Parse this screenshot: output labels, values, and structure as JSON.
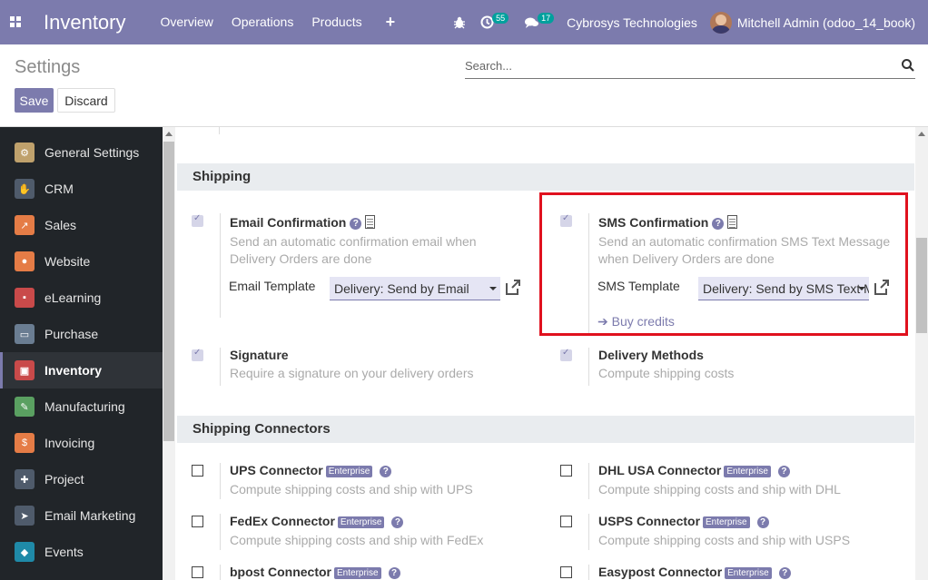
{
  "navbar": {
    "brand": "Inventory",
    "menu": [
      "Overview",
      "Operations",
      "Products"
    ],
    "plus": "+",
    "activity_count": "55",
    "messages_count": "17",
    "company": "Cybrosys Technologies",
    "user": "Mitchell Admin (odoo_14_book)"
  },
  "control": {
    "title": "Settings",
    "save_label": "Save",
    "discard_label": "Discard",
    "search_placeholder": "Search..."
  },
  "sidebar": {
    "items": [
      {
        "label": "General Settings",
        "icon": "gear-icon",
        "color": "#bfa16c"
      },
      {
        "label": "CRM",
        "icon": "handshake-icon",
        "color": "#4f5b6b"
      },
      {
        "label": "Sales",
        "icon": "chart-icon",
        "color": "#e57c46"
      },
      {
        "label": "Website",
        "icon": "globe-icon",
        "color": "#e57c46"
      },
      {
        "label": "eLearning",
        "icon": "elearning-icon",
        "color": "#c94a4a"
      },
      {
        "label": "Purchase",
        "icon": "card-icon",
        "color": "#6a7d92"
      },
      {
        "label": "Inventory",
        "icon": "box-icon",
        "color": "#c94a4a",
        "active": true
      },
      {
        "label": "Manufacturing",
        "icon": "wrench-icon",
        "color": "#5aa061"
      },
      {
        "label": "Invoicing",
        "icon": "invoice-icon",
        "color": "#e57c46"
      },
      {
        "label": "Project",
        "icon": "puzzle-icon",
        "color": "#4f5b6b"
      },
      {
        "label": "Email Marketing",
        "icon": "paper-plane-icon",
        "color": "#4f5b6b"
      },
      {
        "label": "Events",
        "icon": "ticket-icon",
        "color": "#1f8aa8"
      }
    ]
  },
  "shipping": {
    "heading": "Shipping",
    "email": {
      "title": "Email Confirmation",
      "desc": "Send an automatic confirmation email when Delivery Orders are done",
      "template_label": "Email Template",
      "template_value": "Delivery: Send by Email"
    },
    "sms": {
      "title": "SMS Confirmation",
      "desc": "Send an automatic confirmation SMS Text Message when Delivery Orders are done",
      "template_label": "SMS Template",
      "template_value": "Delivery: Send by SMS Text M",
      "buy_credits": "Buy credits"
    },
    "signature": {
      "title": "Signature",
      "desc": "Require a signature on your delivery orders"
    },
    "delivery": {
      "title": "Delivery Methods",
      "desc": "Compute shipping costs"
    }
  },
  "connectors": {
    "heading": "Shipping Connectors",
    "enterprise_label": "Enterprise",
    "ups": {
      "title": "UPS Connector",
      "desc": "Compute shipping costs and ship with UPS"
    },
    "dhl": {
      "title": "DHL USA Connector",
      "desc": "Compute shipping costs and ship with DHL"
    },
    "fedex": {
      "title": "FedEx Connector",
      "desc": "Compute shipping costs and ship with FedEx"
    },
    "usps": {
      "title": "USPS Connector",
      "desc": "Compute shipping costs and ship with USPS"
    },
    "bpost": {
      "title": "bpost Connector"
    },
    "easypost": {
      "title": "Easypost Connector"
    }
  },
  "colors": {
    "brand": "#7c7bad",
    "highlight": "#e0111e",
    "sidebar": "#212529"
  }
}
